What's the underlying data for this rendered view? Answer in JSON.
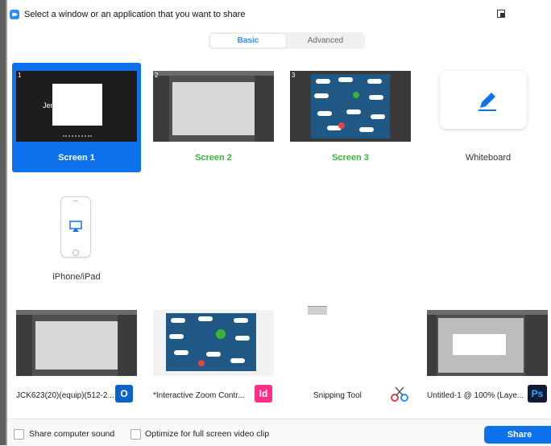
{
  "header": {
    "title": "Select a window or an application that you want to share"
  },
  "tabs": {
    "basic": "Basic",
    "advanced": "Advanced"
  },
  "screens": [
    {
      "number": "1",
      "label": "Screen 1",
      "preview_text": "Jen...  D..."
    },
    {
      "number": "2",
      "label": "Screen 2"
    },
    {
      "number": "3",
      "label": "Screen 3"
    }
  ],
  "whiteboard": {
    "label": "Whiteboard"
  },
  "iphone": {
    "label": "iPhone/iPad"
  },
  "apps": [
    {
      "title": "JCK623(20)(equip)(512-2...",
      "icon": "outlook-icon",
      "icon_text": "O",
      "icon_color": "#0a64c8"
    },
    {
      "title": "*Interactive Zoom Contr...",
      "icon": "indesign-icon",
      "icon_text": "Id",
      "icon_color": "#ff2d8a"
    },
    {
      "title": "Snipping Tool",
      "icon": "scissors-icon"
    },
    {
      "title": "Untitled-1 @ 100% (Laye...",
      "icon": "photoshop-icon",
      "icon_text": "Ps",
      "icon_color": "#0f1b37"
    }
  ],
  "footer": {
    "share_sound": "Share computer sound",
    "optimize_video": "Optimize for full screen video clip",
    "share_button": "Share"
  },
  "colors": {
    "accent": "#0e72ed",
    "green_label": "#3bb43b"
  }
}
